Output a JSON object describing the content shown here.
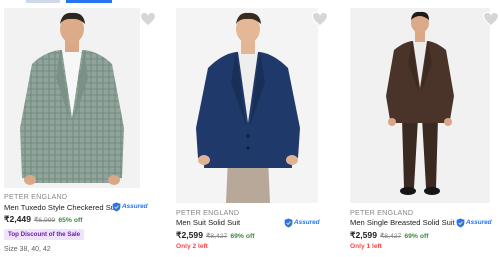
{
  "products": [
    {
      "brand": "PETER ENGLAND",
      "title": "Men Tuxedo Style Checkered Suit",
      "price": "₹2,449",
      "mrp": "₹6,999",
      "discount": "65% off",
      "assured": "Assured",
      "tag": "Top Discount of the Sale",
      "sizes": "Size 38, 40, 42"
    },
    {
      "brand": "PETER ENGLAND",
      "title": "Men Suit Solid Suit",
      "price": "₹2,599",
      "mrp": "₹8,427",
      "discount": "69% off",
      "assured": "Assured",
      "stock": "Only 2 left"
    },
    {
      "brand": "PETER ENGLAND",
      "title": "Men Single Breasted Solid Suit",
      "price": "₹2,599",
      "mrp": "₹8,427",
      "discount": "69% off",
      "assured": "Assured",
      "stock": "Only 1 left"
    }
  ],
  "colors": {
    "accent": "#2874f0",
    "discount": "#388e3c",
    "stock": "#ff4343",
    "tag_bg": "#efe2fb",
    "tag_text": "#6b21a8"
  },
  "icons": [
    "heart-icon",
    "assured-shield-icon"
  ]
}
